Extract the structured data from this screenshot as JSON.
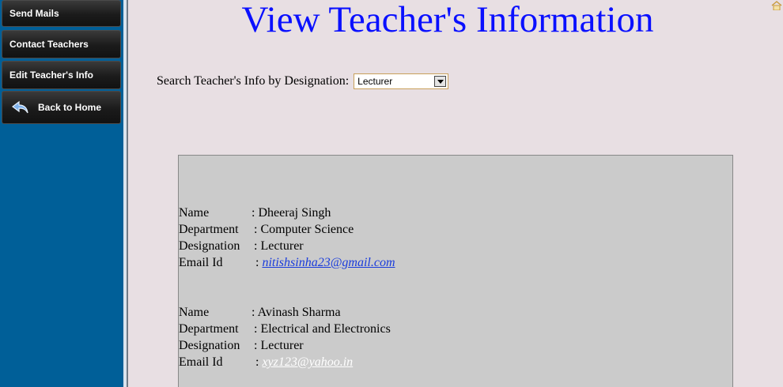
{
  "sidebar": {
    "items": [
      {
        "label": "Send Mails"
      },
      {
        "label": "Contact Teachers"
      },
      {
        "label": "Edit Teacher's Info"
      },
      {
        "label": "Back to Home",
        "icon": "back-arrow-icon"
      }
    ]
  },
  "main": {
    "title": "View Teacher's Information",
    "search": {
      "label": "Search Teacher's Info by Designation:",
      "selected": "Lecturer"
    },
    "teachers": [
      {
        "name_label": "Name",
        "name": ": Dheeraj Singh",
        "department_label": "Department",
        "department": ": Computer Science",
        "designation_label": "Designation",
        "designation": ": Lecturer",
        "email_label": "Email Id",
        "email_prefix": ":",
        "email": "nitishsinha23@gmail.com",
        "email_color": "#1a3cdc"
      },
      {
        "name_label": "Name",
        "name": ": Avinash Sharma",
        "department_label": "Department",
        "department": ": Electrical and Electronics",
        "designation_label": "Designation",
        "designation": ": Lecturer",
        "email_label": "Email Id",
        "email_prefix": ":",
        "email": "xyz123@yahoo.in",
        "email_color": "#ffffff"
      }
    ]
  },
  "colors": {
    "title": "#0a10ff",
    "sidebar": "#005f98",
    "background": "#e8dfe3",
    "panel": "#cbcbcb"
  }
}
